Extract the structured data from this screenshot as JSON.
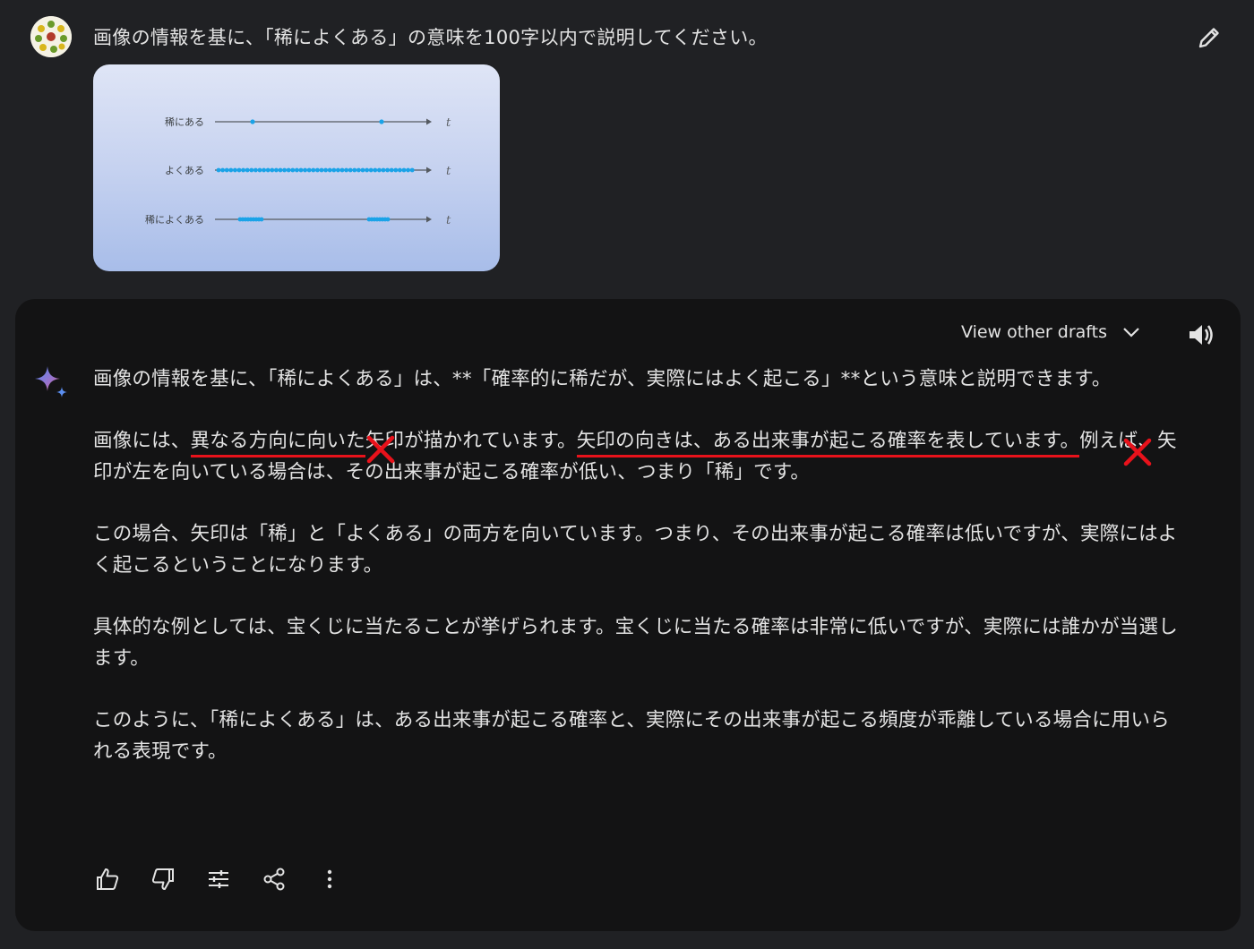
{
  "user_prompt": {
    "text": "画像の情報を基に、「稀によくある」の意味を100字以内で説明してください。",
    "attached_image": {
      "rows": [
        {
          "label": "稀にある",
          "axis_symbol": "t"
        },
        {
          "label": "よくある",
          "axis_symbol": "t"
        },
        {
          "label": "稀によくある",
          "axis_symbol": "t"
        }
      ]
    }
  },
  "response": {
    "view_drafts_label": "View other drafts",
    "paragraphs": {
      "p1": "画像の情報を基に、「稀によくある」は、**「確率的に稀だが、実際にはよく起こる」**という意味と説明できます。",
      "p2_a": "画像には、",
      "p2_b": "異なる方向に向いた",
      "p2_c": "矢印が描かれています。",
      "p2_d": "矢印の向きは、ある出来事が起こる確率を表しています。",
      "p2_e": "例えば、矢印が左を向いている場合は、その出来事が起こる確率が低い、つまり「稀」です。",
      "p3": "この場合、矢印は「稀」と「よくある」の両方を向いています。つまり、その出来事が起こる確率は低いですが、実際にはよく起こるということになります。",
      "p4": "具体的な例としては、宝くじに当たることが挙げられます。宝くじに当たる確率は非常に低いですが、実際には誰かが当選します。",
      "p5": "このように、「稀によくある」は、ある出来事が起こる確率と、実際にその出来事が起こる頻度が乖離している場合に用いられる表現です。"
    }
  },
  "colors": {
    "page_bg": "#202124",
    "response_bg": "#131314",
    "text": "#e3e3e3",
    "annotation_red": "#e8121b",
    "dot_blue": "#1aa3e8"
  },
  "icons": [
    "avatar",
    "edit-icon",
    "chevron-down-icon",
    "speaker-icon",
    "gemini-spark-icon",
    "thumbs-up-icon",
    "thumbs-down-icon",
    "modify-response-icon",
    "share-icon",
    "more-vert-icon",
    "cross-mark-icon"
  ]
}
